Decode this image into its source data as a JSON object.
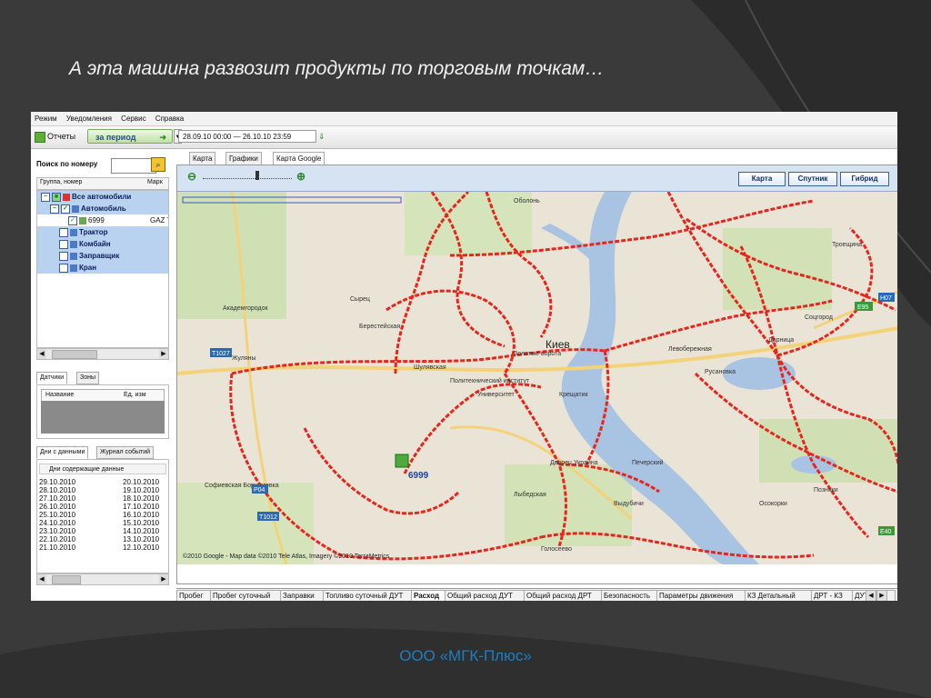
{
  "slide": {
    "title": "А эта машина развозит продукты по торговым точкам…",
    "footer": "ООО «МГК-Плюс»"
  },
  "app": {
    "menu": [
      "Режим",
      "Уведомления",
      "Сервис",
      "Справка"
    ],
    "toolbar": {
      "reports_label": "Отчеты",
      "period_label": "за период",
      "date_range": "28.09.10 00:00 — 26.10.10 23:59"
    },
    "left": {
      "search_label": "Поиск по номеру",
      "search_value": "",
      "tree_columns": [
        "Группа, номер",
        "Марк"
      ],
      "tree": [
        {
          "label": "Все автомобили",
          "type": "group",
          "checked": true
        },
        {
          "label": "Автомобиль",
          "type": "group",
          "checked": true
        },
        {
          "label": "6999",
          "mark": "GAZ T",
          "type": "vehicle",
          "checked": true
        },
        {
          "label": "Трактор",
          "type": "group",
          "checked": false
        },
        {
          "label": "Комбайн",
          "type": "group",
          "checked": false
        },
        {
          "label": "Заправщик",
          "type": "group",
          "checked": false
        },
        {
          "label": "Кран",
          "type": "group",
          "checked": false
        }
      ],
      "sensor_tabs": [
        "Датчики",
        "Зоны"
      ],
      "sensor_columns": [
        "Название",
        "Ед. изм"
      ],
      "days_tabs": [
        "Дни с данными",
        "Журнал событий"
      ],
      "days_header": "Дни содержащие данные",
      "days": [
        [
          "29.10.2010",
          "20.10.2010"
        ],
        [
          "28.10.2010",
          "19.10.2010"
        ],
        [
          "27.10.2010",
          "18.10.2010"
        ],
        [
          "26.10.2010",
          "17.10.2010"
        ],
        [
          "25.10.2010",
          "16.10.2010"
        ],
        [
          "24.10.2010",
          "15.10.2010"
        ],
        [
          "23.10.2010",
          "14.10.2010"
        ],
        [
          "22.10.2010",
          "13.10.2010"
        ],
        [
          "21.10.2010",
          "12.10.2010"
        ]
      ]
    },
    "view_tabs": [
      "Карта",
      "Графики",
      "Карта Google"
    ],
    "map": {
      "buttons": [
        "Карта",
        "Спутник",
        "Гибрид"
      ],
      "city_label": "Киев",
      "vehicle_label": "6999",
      "road_labels": [
        "T1027",
        "T1012",
        "E95",
        "H07",
        "P04",
        "E40"
      ],
      "district_labels": [
        "Оболонь",
        "Академгородок",
        "Жуляны",
        "Левобережная",
        "Дарница",
        "Русановка",
        "Соцгород",
        "Троещина",
        "Печерский",
        "Голосеево",
        "Софиевская Борщаговка",
        "Сырец",
        "Берестейская",
        "Шулявская",
        "Политехнический институт",
        "Университет",
        "Золотые ворота",
        "Крещатик",
        "Дворец Украина",
        "Выдубичи",
        "Лыбедская",
        "Осокорки",
        "Позняки"
      ],
      "copyright": "©2010 Google - Map data ©2010 Tele Atlas, Imagery ©2010 TerraMetrics",
      "route_color": "#e8251c"
    },
    "bottom_tabs": [
      "Пробег",
      "Пробег суточный",
      "Заправки",
      "Топливо суточный ДУТ",
      "Расход",
      "Общий расход ДУТ",
      "Общий расход ДРТ",
      "Безопасность",
      "Параметры движения",
      "КЗ Детальный",
      "ДРТ - КЗ",
      "ДУТ - КЗ"
    ],
    "bottom_active": "Расход"
  }
}
